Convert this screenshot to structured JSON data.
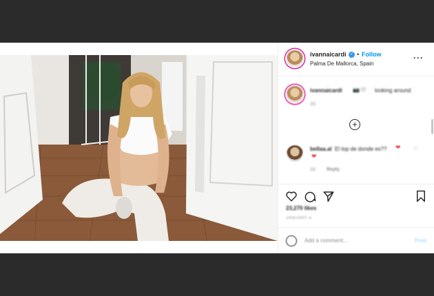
{
  "post": {
    "username": "ivannaicardi",
    "follow_label": "Follow",
    "separator": "•",
    "location": "Palma De Mallorca, Spain",
    "more_label": "···"
  },
  "comments": [
    {
      "username": "ivannaicardi",
      "text": "looking around",
      "meta": "2d"
    },
    {
      "username": "bellaa.al",
      "text": "El top de donde es??",
      "meta": "2d",
      "reply_label": "Reply"
    }
  ],
  "load_more_icon": "plus-circle-icon",
  "likes": "23,270 likes",
  "date": "JANUARY 5",
  "add_comment": {
    "placeholder": "Add a comment...",
    "post_label": "Post"
  },
  "colors": {
    "accent": "#0095f6",
    "verified": "#3897f0",
    "heart": "#ed4956",
    "background": "#2b2b2b"
  }
}
